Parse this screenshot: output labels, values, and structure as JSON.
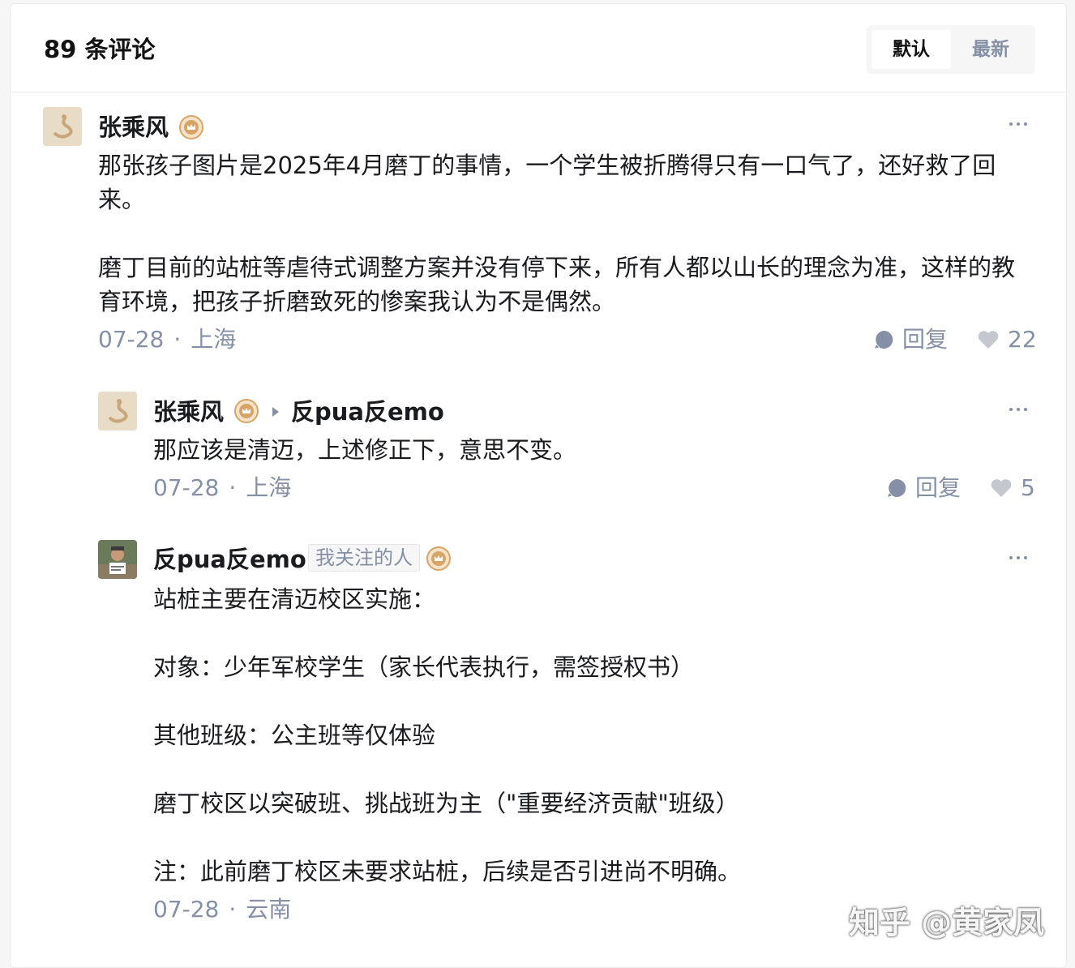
{
  "header": {
    "title": "89 条评论",
    "sort_default": "默认",
    "sort_newest": "最新"
  },
  "comments": [
    {
      "author": "张乘风",
      "body": [
        "那张孩子图片是2025年4月磨丁的事情，一个学生被折腾得只有一口气了，还好救了回来。",
        "",
        "磨丁目前的站桩等虐待式调整方案并没有停下来，所有人都以山长的理念为准，这样的教育环境，把孩子折磨致死的惨案我认为不是偶然。"
      ],
      "date": "07-28",
      "location": "上海",
      "reply_label": "回复",
      "likes": "22"
    },
    {
      "author": "张乘风",
      "reply_to": "反pua反emo",
      "body": [
        "那应该是清迈，上述修正下，意思不变。"
      ],
      "date": "07-28",
      "location": "上海",
      "reply_label": "回复",
      "likes": "5"
    },
    {
      "author": "反pua反emo",
      "tag": "我关注的人",
      "body": [
        "站桩主要在清迈校区实施：",
        "",
        "对象：少年军校学生（家长代表执行，需签授权书）",
        "",
        "其他班级：公主班等仅体验",
        "",
        "磨丁校区以突破班、挑战班为主（\"重要经济贡献\"班级）",
        "",
        "注：此前磨丁校区未要求站桩，后续是否引进尚不明确。"
      ],
      "date": "07-28",
      "location": "云南"
    }
  ],
  "watermark": "知乎 @黄家凤"
}
